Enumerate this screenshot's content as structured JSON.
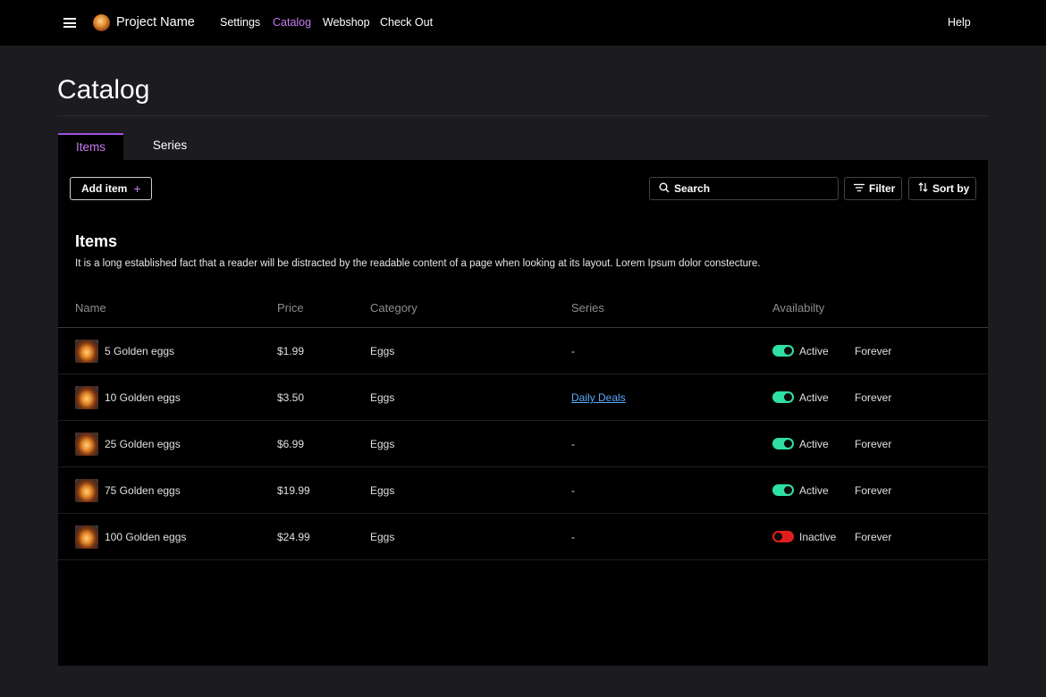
{
  "header": {
    "project_name": "Project Name",
    "nav": [
      "Settings",
      "Catalog",
      "Webshop",
      "Check Out"
    ],
    "active_nav": "Catalog",
    "help": "Help"
  },
  "page": {
    "title": "Catalog"
  },
  "tabs": [
    "Items",
    "Series"
  ],
  "toolbar": {
    "add_item": "Add item",
    "add_icon": "+",
    "search_placeholder": "Search",
    "filter": "Filter",
    "sort": "Sort by"
  },
  "section": {
    "title": "Items",
    "description": "It is a long established fact that a reader will be distracted by the readable content of a page when looking at its layout. Lorem Ipsum dolor constecture."
  },
  "columns": [
    "Name",
    "Price",
    "Category",
    "Series",
    "Availabilty"
  ],
  "rows": [
    {
      "name": "5 Golden eggs",
      "price": "$1.99",
      "category": "Eggs",
      "series": "-",
      "status": "Active",
      "duration": "Forever"
    },
    {
      "name": "10 Golden eggs",
      "price": "$3.50",
      "category": "Eggs",
      "series": "Daily Deals",
      "status": "Active",
      "duration": "Forever"
    },
    {
      "name": "25 Golden eggs",
      "price": "$6.99",
      "category": "Eggs",
      "series": "-",
      "status": "Active",
      "duration": "Forever"
    },
    {
      "name": "75 Golden eggs",
      "price": "$19.99",
      "category": "Eggs",
      "series": "-",
      "status": "Active",
      "duration": "Forever"
    },
    {
      "name": "100 Golden eggs",
      "price": "$24.99",
      "category": "Eggs",
      "series": "-",
      "status": "Inactive",
      "duration": "Forever"
    }
  ],
  "colors": {
    "accent": "#c77cf0",
    "active_toggle": "#2ee0a6",
    "inactive_toggle": "#e01e1e",
    "link": "#5aa9ff"
  },
  "icons": {
    "menu": "hamburger-menu-icon",
    "logo": "golden-egg-logo",
    "search": "search-icon",
    "filter": "filter-icon",
    "sort": "sort-icon",
    "item_thumb": "golden-egg-thumbnail"
  }
}
